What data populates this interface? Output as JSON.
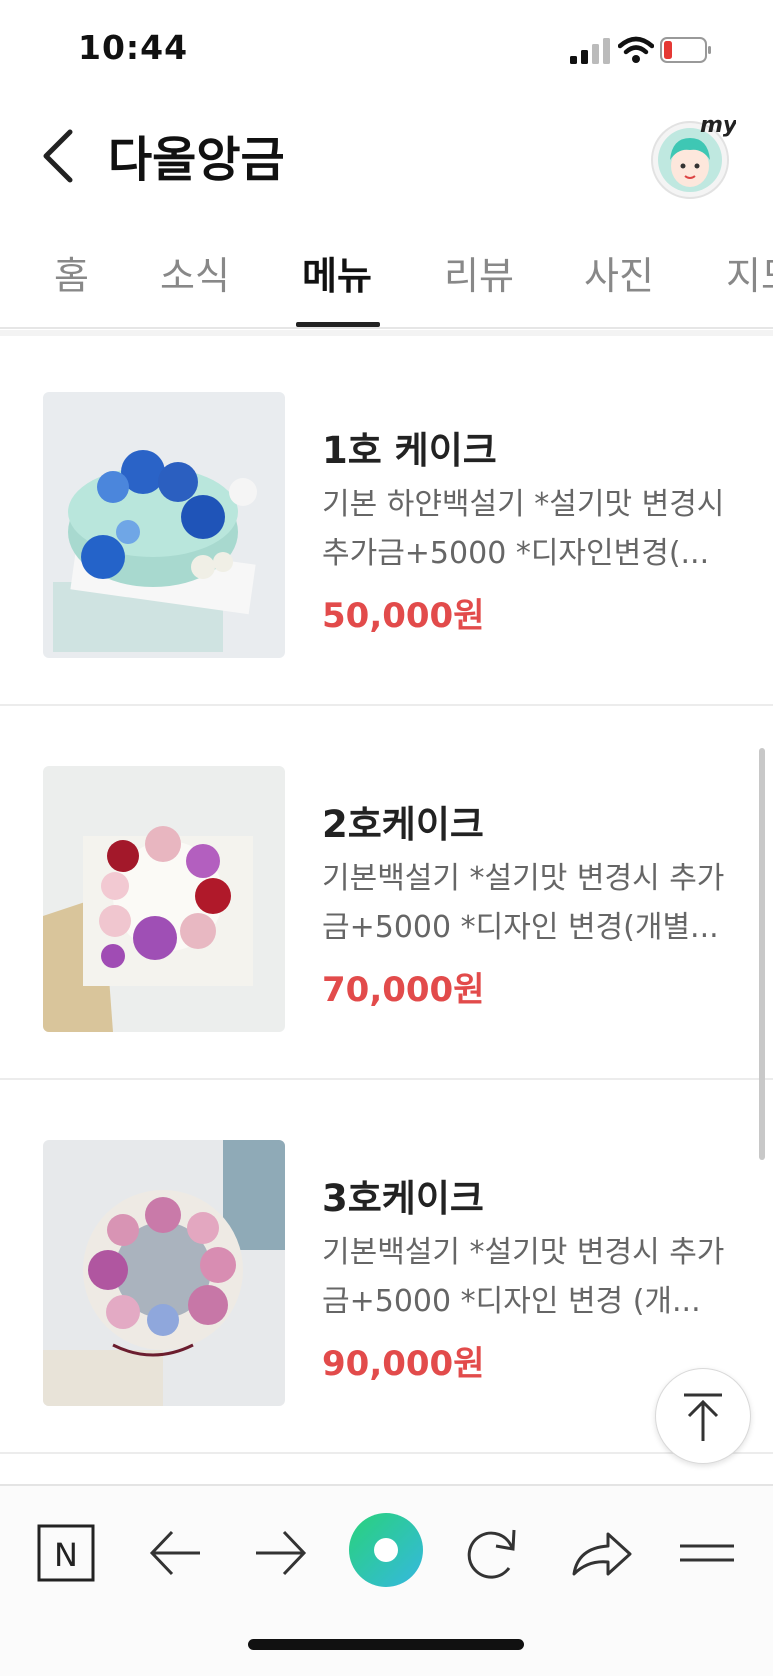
{
  "status_bar": {
    "time": "10:44"
  },
  "header": {
    "title": "다올앙금",
    "avatar_label": "my"
  },
  "tabs": [
    {
      "label": "홈",
      "active": false
    },
    {
      "label": "소식",
      "active": false
    },
    {
      "label": "메뉴",
      "active": true
    },
    {
      "label": "리뷰",
      "active": false
    },
    {
      "label": "사진",
      "active": false
    },
    {
      "label": "지도",
      "active": false
    }
  ],
  "menu_items": [
    {
      "name": "1호 케이크",
      "desc": "기본 하얀백설기 *설기맛 변경시 추가금+5000 *디자인변경(...",
      "price": "50,000원"
    },
    {
      "name": "2호케이크",
      "desc": "기본백설기 *설기맛 변경시 추가금+5000 *디자인 변경(개별...",
      "price": "70,000원"
    },
    {
      "name": "3호케이크",
      "desc": "기본백설기 *설기맛 변경시 추가금+5000 *디자인 변경 (개...",
      "price": "90,000원"
    }
  ],
  "toolbar": {
    "n_label": "N",
    "icons": [
      "naver-n-icon",
      "back-arrow-icon",
      "forward-arrow-icon",
      "green-dot-icon",
      "reload-icon",
      "share-icon",
      "menu-icon"
    ]
  },
  "colors": {
    "price": "#e24b4b",
    "green_dot": "#2fd39a"
  }
}
